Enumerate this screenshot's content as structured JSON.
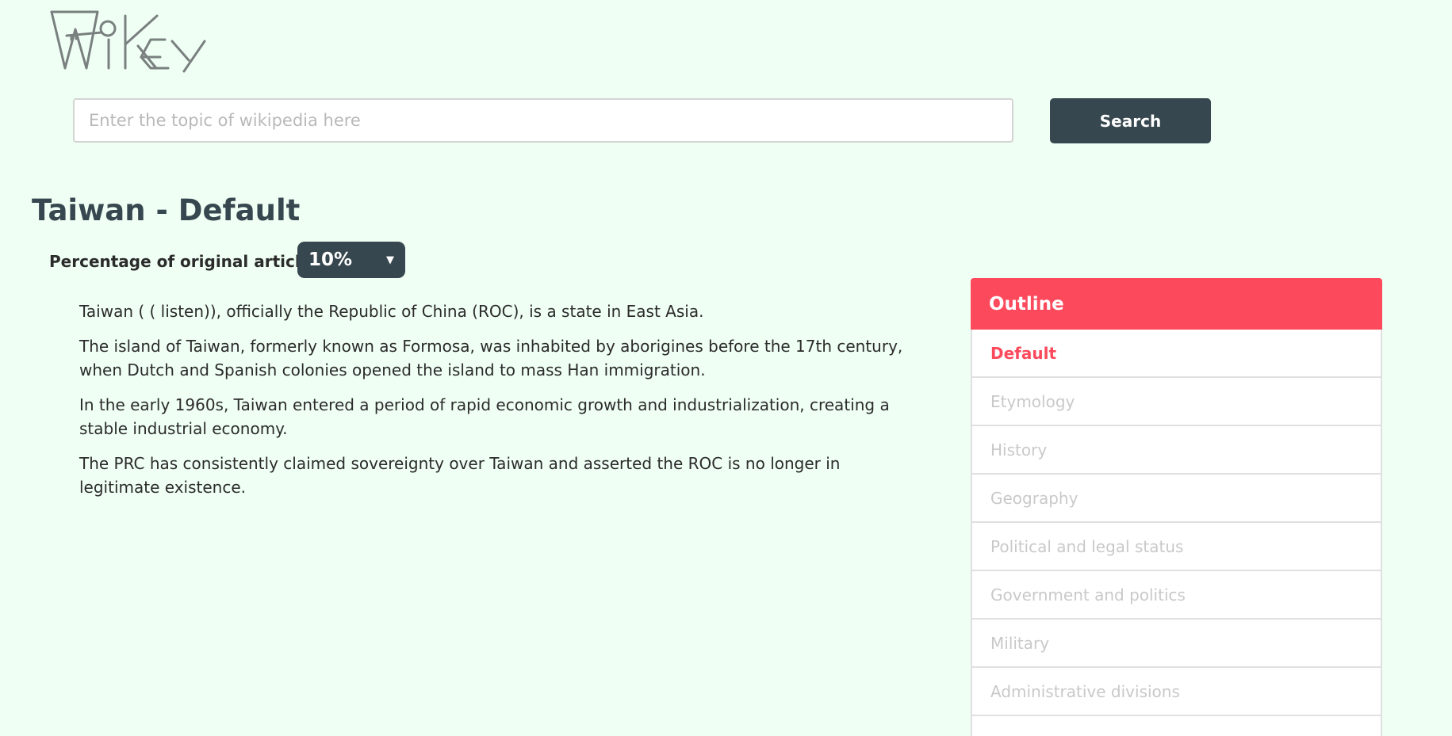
{
  "header": {
    "logo_text": "WiKey"
  },
  "search": {
    "placeholder": "Enter the topic of wikipedia here",
    "value": "",
    "button_label": "Search"
  },
  "main": {
    "title": "Taiwan - Default",
    "percentage_label": "Percentage of original article:",
    "percentage_value": "10%",
    "paragraphs": [
      "Taiwan ( ( listen)), officially the Republic of China (ROC), is a state in East Asia.",
      "The island of Taiwan, formerly known as Formosa, was inhabited by aborigines before the 17th century, when Dutch and Spanish colonies opened the island to mass Han immigration.",
      "In the early 1960s, Taiwan entered a period of rapid economic growth and industrialization, creating a stable industrial economy.",
      "The PRC has consistently claimed sovereignty over Taiwan and asserted the ROC is no longer in legitimate existence."
    ]
  },
  "outline": {
    "title": "Outline",
    "active_index": 0,
    "items": [
      "Default",
      "Etymology",
      "History",
      "Geography",
      "Political and legal status",
      "Government and politics",
      "Military",
      "Administrative divisions",
      ""
    ]
  },
  "colors": {
    "background": "#effff4",
    "dark_slate": "#37474f",
    "accent_red": "#fc4a5c",
    "muted_text": "#c9c9c9"
  }
}
